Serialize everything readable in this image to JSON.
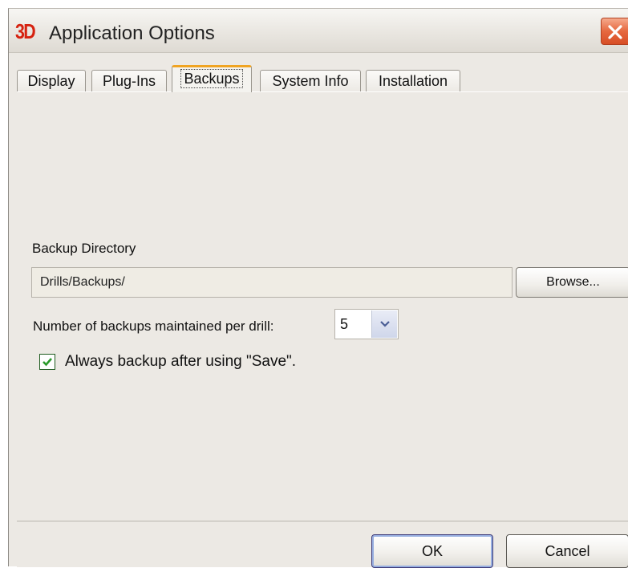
{
  "window": {
    "logo_text": "3D",
    "title": "Application Options"
  },
  "tabs": [
    {
      "label": "Display",
      "active": false
    },
    {
      "label": "Plug-Ins",
      "active": false
    },
    {
      "label": "Backups",
      "active": true
    },
    {
      "label": "System Info",
      "active": false
    },
    {
      "label": "Installation",
      "active": false
    }
  ],
  "backups": {
    "directory_label": "Backup Directory",
    "directory_value": "Drills/Backups/",
    "browse_label": "Browse...",
    "count_label": "Number of backups maintained per drill:",
    "count_value": "5",
    "always_backup_label": "Always backup after using \"Save\".",
    "always_backup_checked": true
  },
  "footer": {
    "ok_label": "OK",
    "cancel_label": "Cancel"
  },
  "colors": {
    "logo": "#d62210",
    "active_tab_accent": "#f0a422",
    "close_button": "#e6683f",
    "checkbox_check": "#2b9a2b"
  },
  "icons": {
    "close": "close-icon",
    "dropdown": "chevron-down-icon",
    "check": "checkmark-icon"
  }
}
